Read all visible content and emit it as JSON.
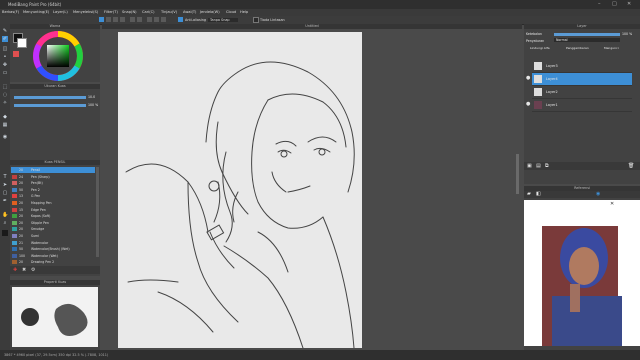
{
  "app": {
    "title": "MediBang Paint Pro (64bit)"
  },
  "menu": {
    "items": [
      "Berkas(F)",
      "Menyunting(E)",
      "Layer(L)",
      "Menyeleksi(S)",
      "Filter(T)",
      "Snap(N)",
      "Cari(C)",
      "Tinjau(V)",
      "Awal(T)",
      "Jendela(W)",
      "Cloud",
      "Help"
    ]
  },
  "command_bar": {
    "anti_alias_label": "Anti-aliasing",
    "snap_label": "Tanpa Snap",
    "tool_label": "Tiada Lintasan"
  },
  "panels": {
    "color": {
      "title": "Warna"
    },
    "brush_size": {
      "title": "Ukuran Kuas",
      "size_value": "10.0",
      "opacity_value": "100 %"
    },
    "brush_list": {
      "title": "Kuas PENSIL",
      "items": [
        {
          "size": "20",
          "name": "Pensil",
          "color": "#3d8fd6"
        },
        {
          "size": "24",
          "name": "Pen (Sharp)",
          "color": "#c04040"
        },
        {
          "size": "20",
          "name": "Pen(Bt)",
          "color": "#d06060"
        },
        {
          "size": "50",
          "name": "Pen 2",
          "color": "#4080c0"
        },
        {
          "size": "13",
          "name": "G Pen",
          "color": "#e04040"
        },
        {
          "size": "20",
          "name": "Mapping Pen",
          "color": "#e06020"
        },
        {
          "size": "15",
          "name": "Edge Pen",
          "color": "#d04040"
        },
        {
          "size": "20",
          "name": "Kapas (Soft)",
          "color": "#40a040"
        },
        {
          "size": "20",
          "name": "Stipple Pen",
          "color": "#60b060"
        },
        {
          "size": "20",
          "name": "Smudge",
          "color": "#30a0a0"
        },
        {
          "size": "20",
          "name": "Sumi",
          "color": "#8080c0"
        },
        {
          "size": "21",
          "name": "Watercolor",
          "color": "#40a0d0"
        },
        {
          "size": "50",
          "name": "Watercolor(Brush) (Wet)",
          "color": "#3070b0"
        },
        {
          "size": "100",
          "name": "Watercolor (Wet)",
          "color": "#4060a0"
        },
        {
          "size": "20",
          "name": "Drawing Pen 2",
          "color": "#a06030"
        }
      ]
    },
    "tool_property": {
      "title": "Properti Kuas"
    },
    "canvas": {
      "title": "Untitled"
    },
    "layer": {
      "title": "Layer",
      "opacity_label": "Ketebalan",
      "opacity_value": "100 %",
      "blend_label": "Penyaturan",
      "blend_value": "Normal",
      "protect_alpha": "Lindungi Alfa",
      "clipping": "Penggambaran",
      "lock": "Mengunci",
      "layers": [
        "Layer3",
        "Layer4",
        "Layer2",
        "Layer1"
      ],
      "selected": "Layer4"
    },
    "reference": {
      "title": "Referensi"
    }
  },
  "statusbar": {
    "text": "3867 * 4960 pixel  (37, 29.5cm)  350 dpi  32.5 %  (-7808, 1011)"
  },
  "colors": {
    "accent": "#3d8fd6",
    "panel": "#424242",
    "canvas_bg": "#4a4a4a",
    "paper": "#e9e9e9"
  }
}
